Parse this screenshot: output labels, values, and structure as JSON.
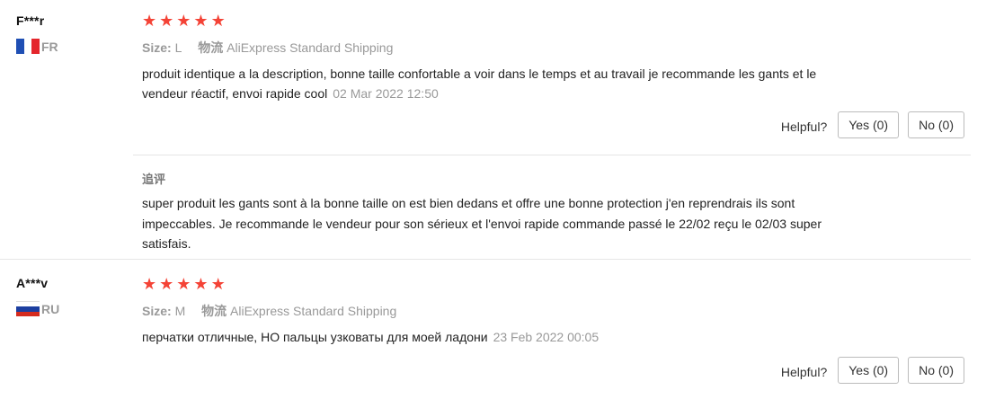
{
  "reviews": [
    {
      "user": "F***r",
      "country": "FR",
      "meta": {
        "size_key": "Size:",
        "size_val": "L",
        "ship_key": "物流",
        "ship_val": "AliExpress Standard Shipping"
      },
      "text": "produit identique a la description, bonne taille confortable a voir dans le temps et au travail je recommande les gants et le vendeur réactif, envoi rapide cool",
      "date": "02 Mar 2022 12:50",
      "helpful_label": "Helpful?",
      "yes": "Yes (0)",
      "no": "No (0)",
      "append": {
        "title": "追评",
        "text": "super produit les gants sont à la bonne taille on est bien dedans et offre une bonne protection j'en reprendrais ils sont impeccables. Je recommande le vendeur pour son sérieux et l'envoi rapide commande passé le 22/02 reçu le 02/03 super satisfais."
      }
    },
    {
      "user": "A***v",
      "country": "RU",
      "meta": {
        "size_key": "Size:",
        "size_val": "M",
        "ship_key": "物流",
        "ship_val": "AliExpress Standard Shipping"
      },
      "text": "перчатки отличные, НО пальцы узковаты для моей ладони",
      "date": "23 Feb 2022 00:05",
      "helpful_label": "Helpful?",
      "yes": "Yes (0)",
      "no": "No (0)"
    }
  ],
  "rating_stars": 5,
  "colors": {
    "star": "#f44336",
    "fr_blue": "#1f4fb4",
    "fr_red": "#e4262c",
    "ru_blue": "#1c3fa0",
    "ru_red": "#d52b1e"
  }
}
